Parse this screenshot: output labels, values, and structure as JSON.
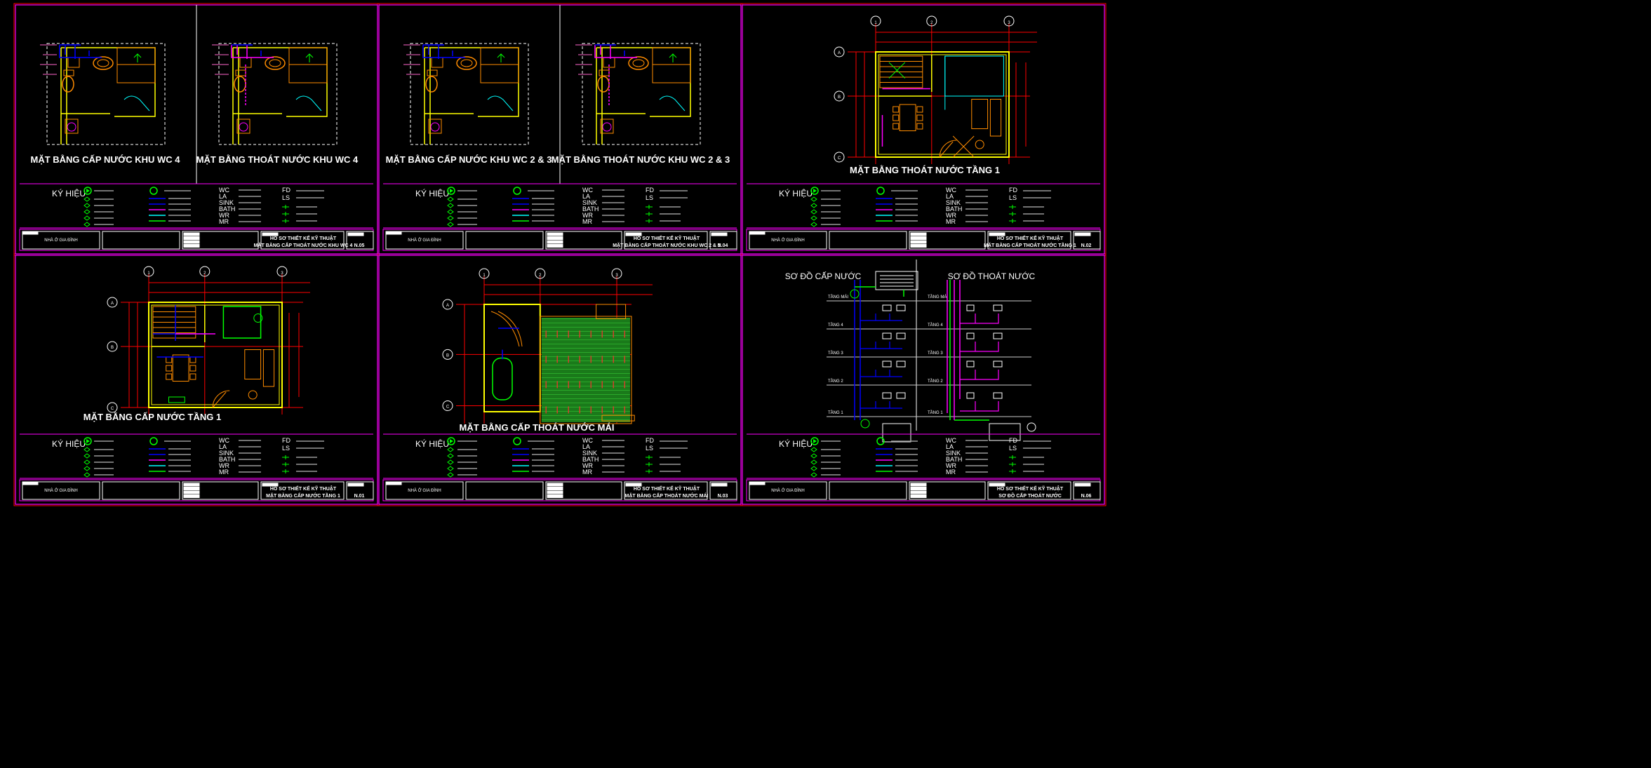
{
  "sheets": [
    {
      "id": "s1",
      "kind": "wc",
      "titles": [
        "MẶT BẰNG CẤP NƯỚC KHU WC 4",
        "MẶT BẰNG THOÁT NƯỚC KHU WC 4"
      ],
      "project": "NHÀ Ở GIA ĐÌNH",
      "tb_title1": "HỒ SƠ THIẾT KẾ KỸ THUẬT",
      "tb_title2": "MẶT BẰNG CẤP THOÁT NƯỚC KHU WC 4",
      "sheet_no": "N.05"
    },
    {
      "id": "s2",
      "kind": "wc",
      "titles": [
        "MẶT BẰNG CẤP NƯỚC KHU WC 2 & 3",
        "MẶT BẰNG THOÁT NƯỚC KHU WC 2 & 3"
      ],
      "project": "NHÀ Ở GIA ĐÌNH",
      "tb_title1": "HỒ SƠ THIẾT KẾ KỸ THUẬT",
      "tb_title2": "MẶT BẰNG CẤP THOÁT NƯỚC KHU WC 2 & 3",
      "sheet_no": "N.04"
    },
    {
      "id": "s3",
      "kind": "floor",
      "titles": [
        "MẶT BẰNG THOÁT NƯỚC TẦNG 1"
      ],
      "project": "NHÀ Ở GIA ĐÌNH",
      "tb_title1": "HỒ SƠ THIẾT KẾ KỸ THUẬT",
      "tb_title2": "MẶT BẰNG CẤP THOÁT NƯỚC TẦNG 1",
      "sheet_no": "N.02"
    },
    {
      "id": "s4",
      "kind": "floor",
      "titles": [
        "MẶT BẰNG CẤP NƯỚC TẦNG 1"
      ],
      "project": "NHÀ Ở GIA ĐÌNH",
      "tb_title1": "HỒ SƠ THIẾT KẾ KỸ THUẬT",
      "tb_title2": "MẶT BẰNG CẤP NƯỚC TẦNG 1",
      "sheet_no": "N.01"
    },
    {
      "id": "s5",
      "kind": "roof",
      "titles": [
        "MẶT BẰNG CẤP THOÁT NƯỚC MÁI"
      ],
      "project": "NHÀ Ở GIA ĐÌNH",
      "tb_title1": "HỒ SƠ THIẾT KẾ KỸ THUẬT",
      "tb_title2": "MẶT BẰNG CẤP THOÁT NƯỚC MÁI",
      "sheet_no": "N.03"
    },
    {
      "id": "s6",
      "kind": "riser",
      "titles": [
        "SƠ ĐỒ CẤP NƯỚC",
        "SƠ ĐỒ THOÁT NƯỚC"
      ],
      "project": "NHÀ Ở GIA ĐÌNH",
      "tb_title1": "HỒ SƠ THIẾT KẾ KỸ THUẬT",
      "tb_title2": "SƠ ĐỒ CẤP THOÁT NƯỚC",
      "sheet_no": "N.06"
    }
  ],
  "legend": {
    "heading": "KÝ HIỆU",
    "codes": [
      "WC",
      "LA",
      "SINK",
      "BATH",
      "WR",
      "MR",
      "FD",
      "LS"
    ]
  },
  "grid_marks": [
    "1",
    "2",
    "3",
    "A",
    "B",
    "C"
  ],
  "riser_floors": [
    "TẦNG MÁI",
    "TẦNG 4",
    "TẦNG 3",
    "TẦNG 2",
    "TẦNG 1"
  ],
  "colors": {
    "frame": "#ff0000",
    "border": "#ff00ff",
    "wall": "#ffff00",
    "furniture": "#ff8c00",
    "supply": "#0000ff",
    "drain": "#ff00ff",
    "fixture": "#00ffff",
    "pipe_green": "#00ff00",
    "roof_tile": "#1a7a1a",
    "dash": "#ffffff"
  }
}
